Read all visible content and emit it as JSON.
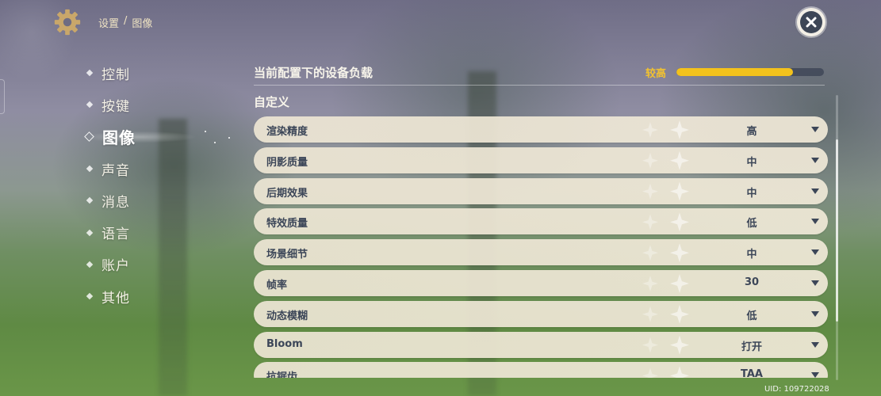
{
  "header": {
    "breadcrumb": [
      "设置",
      "图像"
    ],
    "breadcrumb_separator": "/",
    "gear_icon": "gear-icon",
    "close_icon": "close-icon"
  },
  "nav": {
    "items": [
      {
        "label": "控制",
        "active": false
      },
      {
        "label": "按键",
        "active": false
      },
      {
        "label": "图像",
        "active": true
      },
      {
        "label": "声音",
        "active": false
      },
      {
        "label": "消息",
        "active": false
      },
      {
        "label": "语言",
        "active": false
      },
      {
        "label": "账户",
        "active": false
      },
      {
        "label": "其他",
        "active": false
      }
    ]
  },
  "main": {
    "load_title": "当前配置下的设备负载",
    "load_level": "较高",
    "load_fraction": 0.79,
    "section_title": "自定义",
    "settings": [
      {
        "label": "渲染精度",
        "value": "高"
      },
      {
        "label": "阴影质量",
        "value": "中"
      },
      {
        "label": "后期效果",
        "value": "中"
      },
      {
        "label": "特效质量",
        "value": "低"
      },
      {
        "label": "场景细节",
        "value": "中"
      },
      {
        "label": "帧率",
        "value": "30"
      },
      {
        "label": "动态模糊",
        "value": "低"
      },
      {
        "label": "Bloom",
        "value": "打开"
      },
      {
        "label": "抗锯齿",
        "value": "TAA"
      }
    ]
  },
  "footer": {
    "uid": "UID: 109722028"
  },
  "colors": {
    "accent": "#f3c21c",
    "row_text": "#3c4658",
    "breadcrumb": "#efe3c3"
  }
}
